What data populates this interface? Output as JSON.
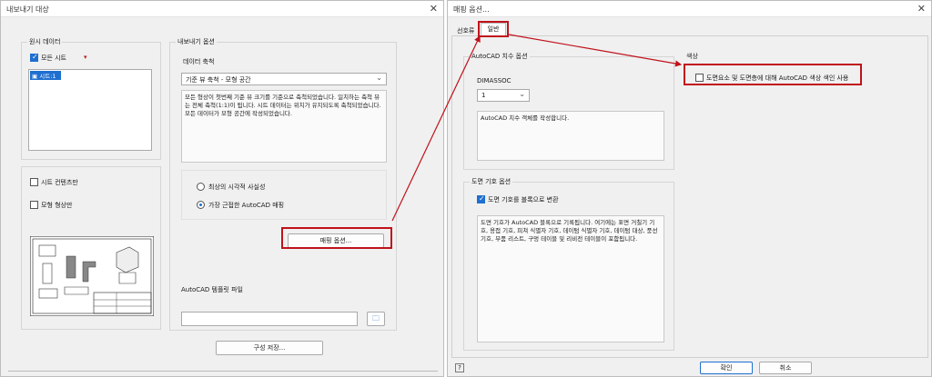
{
  "left": {
    "title": "내보내기 대상",
    "source_group": "원시 데이터",
    "all_sheets": "모든 시트",
    "sheet_item": "시트:1",
    "export_options_group": "내보내기 옵션",
    "data_scale_label": "데이터 축척",
    "data_scale_value": "기준 뷰 축척 - 모형 공간",
    "data_scale_desc": "모든 형상이 첫번째 기준 뷰 크기를 기준으로 축척되었습니다. 일치하는 축척 뷰는 전체 축척(1:1)이 됩니다. 시트 데이터는 위치가 유지되도록 축척되었습니다. 모든 데이터가 모형 공간에 작성되었습니다.",
    "sheet_contents_only": "시트 컨텐츠만",
    "model_geometry_only": "모형 형상만",
    "radio_visual": "최상의 시각적 사실성",
    "radio_autocad": "가장 근접한 AutoCAD 매핑",
    "mapping_button": "매핑 옵션...",
    "template_label": "AutoCAD 템플릿 파일",
    "save_config_button": "구성 저장..."
  },
  "right": {
    "title": "매핑 옵션...",
    "tab_preferences": "선호류",
    "tab_general": "일반",
    "dim_group": "AutoCAD 치수 옵션",
    "dimassoc_label": "DIMASSOC",
    "dimassoc_value": "1",
    "dim_desc": "AutoCAD 치수 객체를 작성합니다.",
    "symbol_group": "도면 기호 옵션",
    "symbol_checkbox": "도면 기호를 블록으로 변환",
    "symbol_desc": "도면 기호가 AutoCAD 블록으로 기록됩니다. 여기에는 표면 거칠기 기호, 용접 기호, 피쳐 식별자 기호, 데이텀 식별자 기호, 데이텀 대상, 풍선기호, 부품 리스트, 구멍 테이블 및 리비전 테이블이 포함됩니다.",
    "color_group": "색상",
    "color_checkbox": "도면요소 및 도면층에 대해 AutoCAD 색상 색인 사용",
    "ok_button": "확인",
    "cancel_button": "취소"
  },
  "colors": {
    "accent": "#1e6fd0",
    "highlight": "#c0121c"
  }
}
